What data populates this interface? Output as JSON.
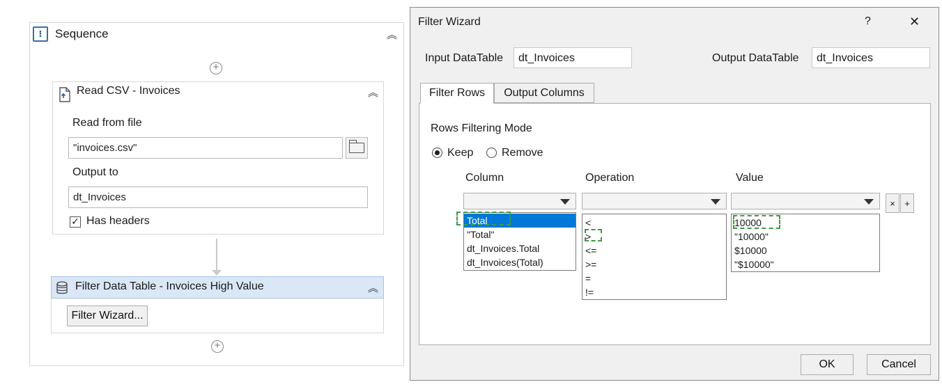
{
  "workflow": {
    "sequence_title": "Sequence",
    "read_csv": {
      "title": "Read CSV - Invoices",
      "read_from_file_label": "Read from file",
      "read_from_file_value": "\"invoices.csv\"",
      "output_to_label": "Output to",
      "output_to_value": "dt_Invoices",
      "has_headers_label": "Has headers",
      "has_headers_checked": true
    },
    "filter_table": {
      "title": "Filter Data Table - Invoices High Value",
      "wizard_button_label": "Filter Wizard..."
    }
  },
  "dialog": {
    "title": "Filter Wizard",
    "help_label": "?",
    "close_label": "✕",
    "input_dt_label": "Input DataTable",
    "input_dt_value": "dt_Invoices",
    "output_dt_label": "Output DataTable",
    "output_dt_value": "dt_Invoices",
    "tabs": [
      "Filter Rows",
      "Output Columns"
    ],
    "mode_label": "Rows Filtering Mode",
    "keep_label": "Keep",
    "remove_label": "Remove",
    "keep_selected": true,
    "columns": {
      "column_header": "Column",
      "operation_header": "Operation",
      "value_header": "Value"
    },
    "column_options": [
      "Total",
      "\"Total\"",
      "dt_Invoices.Total",
      "dt_Invoices(Total)"
    ],
    "operation_options": [
      "<",
      ">",
      "<=",
      ">=",
      "=",
      "!="
    ],
    "value_options": [
      "10000",
      "\"10000\"",
      "$10000",
      "\"$10000\""
    ],
    "remove_row_label": "×",
    "add_row_label": "+",
    "ok_label": "OK",
    "cancel_label": "Cancel"
  },
  "colors": {
    "selection": "#0078d7",
    "highlight_dash": "#3c9a44",
    "activity_header": "#d9e7f6"
  },
  "icons": [
    "sequence-icon",
    "collapse-chevron-icon",
    "add-activity-icon",
    "read-csv-icon",
    "folder-icon",
    "checkmark-icon",
    "datatable-icon",
    "dropdown-arrow-icon",
    "help-icon",
    "close-icon",
    "radio-icon"
  ]
}
